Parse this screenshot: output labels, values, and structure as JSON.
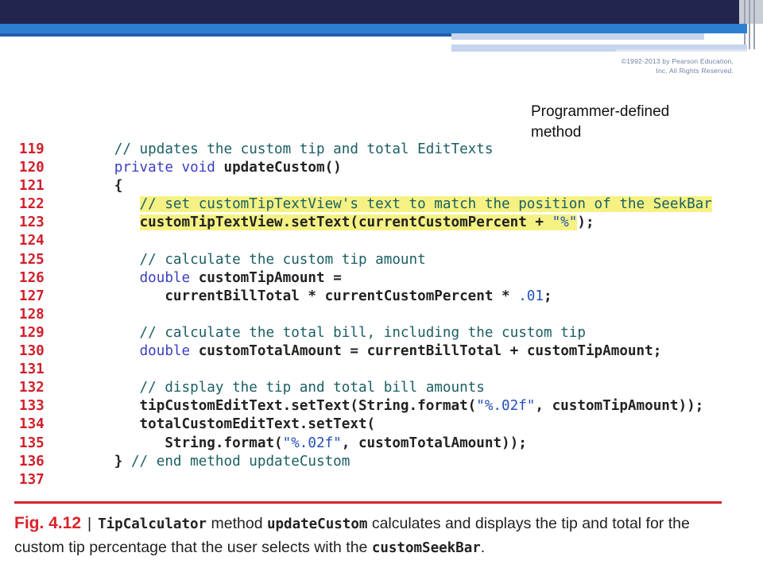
{
  "slide": {
    "copyright": "©1992-2013 by Pearson Education, Inc. All Rights Reserved.",
    "callout": "Programmer-defined method"
  },
  "code": [
    {
      "n": "119",
      "parts": [
        {
          "t": "   // updates the custom tip and total EditTexts",
          "c": "comment"
        }
      ]
    },
    {
      "n": "120",
      "parts": [
        {
          "t": "   ",
          "c": ""
        },
        {
          "t": "private void",
          "c": "kw"
        },
        {
          "t": " updateCustom()",
          "c": "txt"
        }
      ]
    },
    {
      "n": "121",
      "parts": [
        {
          "t": "   {",
          "c": "txt"
        }
      ]
    },
    {
      "n": "122",
      "parts": [
        {
          "t": "      ",
          "c": ""
        },
        {
          "t": "// set customTipTextView's text to match the position of the SeekBar",
          "c": "comment hl"
        }
      ]
    },
    {
      "n": "123",
      "parts": [
        {
          "t": "      ",
          "c": ""
        },
        {
          "t": "customTipTextView.setText(currentCustomPercent + ",
          "c": "txt hl"
        },
        {
          "t": "\"%\"",
          "c": "str hl"
        },
        {
          "t": ");",
          "c": "txt"
        }
      ]
    },
    {
      "n": "124",
      "parts": []
    },
    {
      "n": "125",
      "parts": [
        {
          "t": "      // calculate the custom tip amount",
          "c": "comment"
        }
      ]
    },
    {
      "n": "126",
      "parts": [
        {
          "t": "      ",
          "c": ""
        },
        {
          "t": "double",
          "c": "kw"
        },
        {
          "t": " customTipAmount =",
          "c": "txt"
        }
      ]
    },
    {
      "n": "127",
      "parts": [
        {
          "t": "         currentBillTotal * currentCustomPercent * ",
          "c": "txt"
        },
        {
          "t": ".01",
          "c": "num"
        },
        {
          "t": ";",
          "c": "txt"
        }
      ]
    },
    {
      "n": "128",
      "parts": []
    },
    {
      "n": "129",
      "parts": [
        {
          "t": "      // calculate the total bill, including the custom tip",
          "c": "comment"
        }
      ]
    },
    {
      "n": "130",
      "parts": [
        {
          "t": "      ",
          "c": ""
        },
        {
          "t": "double",
          "c": "kw"
        },
        {
          "t": " customTotalAmount = currentBillTotal + customTipAmount;",
          "c": "txt"
        }
      ]
    },
    {
      "n": "131",
      "parts": []
    },
    {
      "n": "132",
      "parts": [
        {
          "t": "      // display the tip and total bill amounts",
          "c": "comment"
        }
      ]
    },
    {
      "n": "133",
      "parts": [
        {
          "t": "      tipCustomEditText.setText(String.format(",
          "c": "txt"
        },
        {
          "t": "\"%.02f\"",
          "c": "str"
        },
        {
          "t": ", customTipAmount));",
          "c": "txt"
        }
      ]
    },
    {
      "n": "134",
      "parts": [
        {
          "t": "      totalCustomEditText.setText(",
          "c": "txt"
        }
      ]
    },
    {
      "n": "135",
      "parts": [
        {
          "t": "         String.format(",
          "c": "txt"
        },
        {
          "t": "\"%.02f\"",
          "c": "str"
        },
        {
          "t": ", customTotalAmount));",
          "c": "txt"
        }
      ]
    },
    {
      "n": "136",
      "parts": [
        {
          "t": "   } ",
          "c": "txt"
        },
        {
          "t": "// end method updateCustom",
          "c": "comment"
        }
      ]
    },
    {
      "n": "137",
      "parts": []
    }
  ],
  "caption": {
    "fig_label": "Fig. 4.12",
    "separator": "|",
    "class_name": "TipCalculator",
    "text1": " method ",
    "method_name": "updateCustom",
    "text2": " calculates and displays the tip and total for the custom tip percentage that the user selects with the ",
    "control_name": "customSeekBar",
    "text3": "."
  },
  "colors": {
    "header": "#22264e",
    "accent_blue": "#2f7fd1",
    "line_number": "#d0202a",
    "highlight": "#f5f283",
    "rule": "#d8232a"
  }
}
